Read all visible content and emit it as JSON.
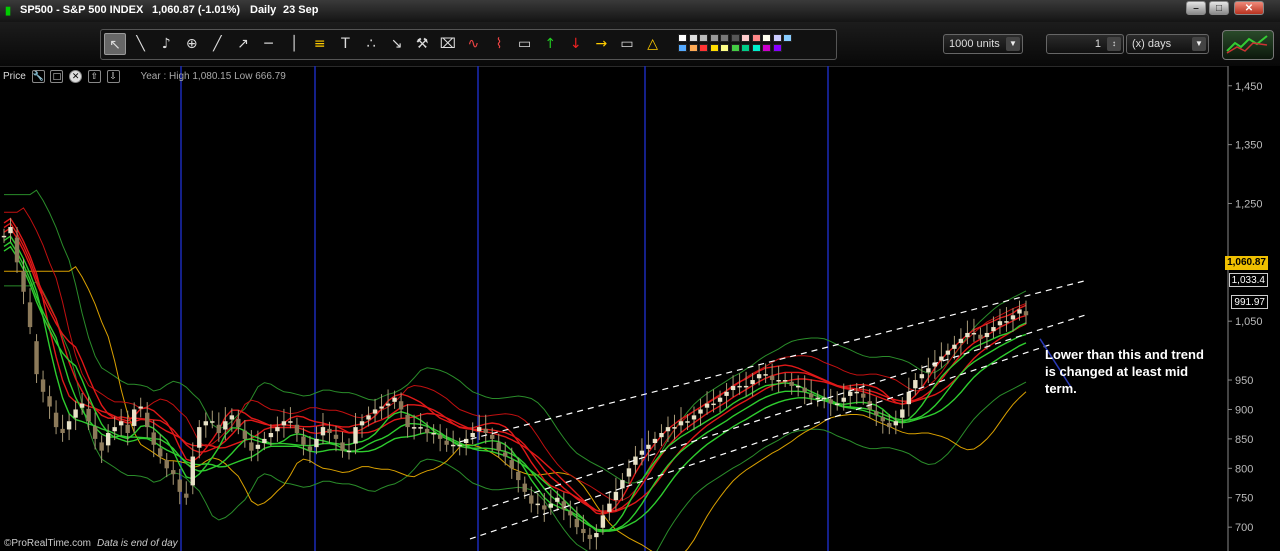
{
  "titlebar": {
    "symbol": "SP500 - S&P 500 INDEX",
    "quote": "1,060.87 (-1.01%)",
    "period": "Daily",
    "date": "23 Sep"
  },
  "toolbar": {
    "tool_icons": [
      "cursor-icon",
      "ruler-icon",
      "bell-icon",
      "zoom-icon",
      "line-icon",
      "ray-icon",
      "horizontal-line-icon",
      "vertical-line-icon",
      "fibonacci-icon",
      "text-icon",
      "point-icon",
      "fan-icon",
      "tools-icon",
      "trash-icon",
      "wave-icon",
      "zigzag-icon",
      "rectangle-icon",
      "up-arrow-icon",
      "down-arrow-icon",
      "right-arrow-icon",
      "channel-icon",
      "triangle-icon"
    ],
    "units_value": "1000 units",
    "period_count": "1",
    "period_unit": "(x) days"
  },
  "price_panel": {
    "label": "Price",
    "year_range": "Year : High 1,080.15 Low 666.79"
  },
  "price_labels": {
    "last": "1,060.87",
    "level_a": "1,033.4",
    "level_b": "991.97"
  },
  "annotation": "Lower than this and trend is changed at least mid term.",
  "footer": {
    "brand": "©ProRealTime.com",
    "note": "Data is end of day"
  },
  "chart_data": {
    "type": "candlestick",
    "title": "SP500 - S&P 500 INDEX",
    "y_axis_ticks": [
      1450,
      1350,
      1250,
      1150,
      1050,
      950,
      900,
      850,
      800,
      750,
      700
    ],
    "y_axis_tick_labels": [
      "1,450",
      "1,350",
      "1,250",
      "1,150",
      "1,050",
      "950",
      "900",
      "850",
      "800",
      "750",
      "700"
    ],
    "ylim": [
      668,
      1470
    ],
    "grid": false,
    "year_high": 1080.15,
    "year_low": 666.79,
    "last": 1060.87,
    "change_pct": -1.01,
    "colors": {
      "bull": "#e8e2c8",
      "bear": "#8c7a5a",
      "ma_red": "#e01818",
      "ma_green": "#2ecc2e",
      "channel": "#ffffff",
      "band_orange": "#d9a000",
      "separator": "#1a2ab8"
    },
    "series": [
      {
        "kind": "price",
        "closes": [
          1195,
          1210,
          1150,
          1100,
          1040,
          960,
          930,
          905,
          870,
          860,
          880,
          900,
          910,
          880,
          850,
          830,
          860,
          870,
          880,
          860,
          900,
          905,
          870,
          840,
          820,
          800,
          790,
          760,
          750,
          820,
          870,
          880,
          880,
          860,
          880,
          890,
          870,
          850,
          830,
          840,
          850,
          860,
          870,
          880,
          880,
          860,
          840,
          830,
          850,
          870,
          860,
          850,
          830,
          830,
          870,
          880,
          890,
          900,
          905,
          910,
          920,
          900,
          870,
          870,
          870,
          860,
          860,
          850,
          840,
          840,
          840,
          850,
          860,
          870,
          860,
          850,
          830,
          820,
          800,
          780,
          760,
          740,
          740,
          730,
          740,
          750,
          730,
          720,
          700,
          690,
          680,
          690,
          720,
          740,
          760,
          780,
          800,
          820,
          830,
          840,
          850,
          860,
          870,
          870,
          880,
          880,
          890,
          900,
          910,
          910,
          920,
          930,
          940,
          940,
          940,
          950,
          960,
          960,
          950,
          950,
          950,
          940,
          940,
          930,
          920,
          920,
          920,
          910,
          910,
          920,
          930,
          930,
          920,
          900,
          890,
          880,
          870,
          880,
          900,
          930,
          950,
          960,
          970,
          980,
          990,
          1000,
          1010,
          1020,
          1030,
          1030,
          1020,
          1030,
          1040,
          1050,
          1050,
          1060,
          1070,
          1060
        ]
      }
    ]
  }
}
